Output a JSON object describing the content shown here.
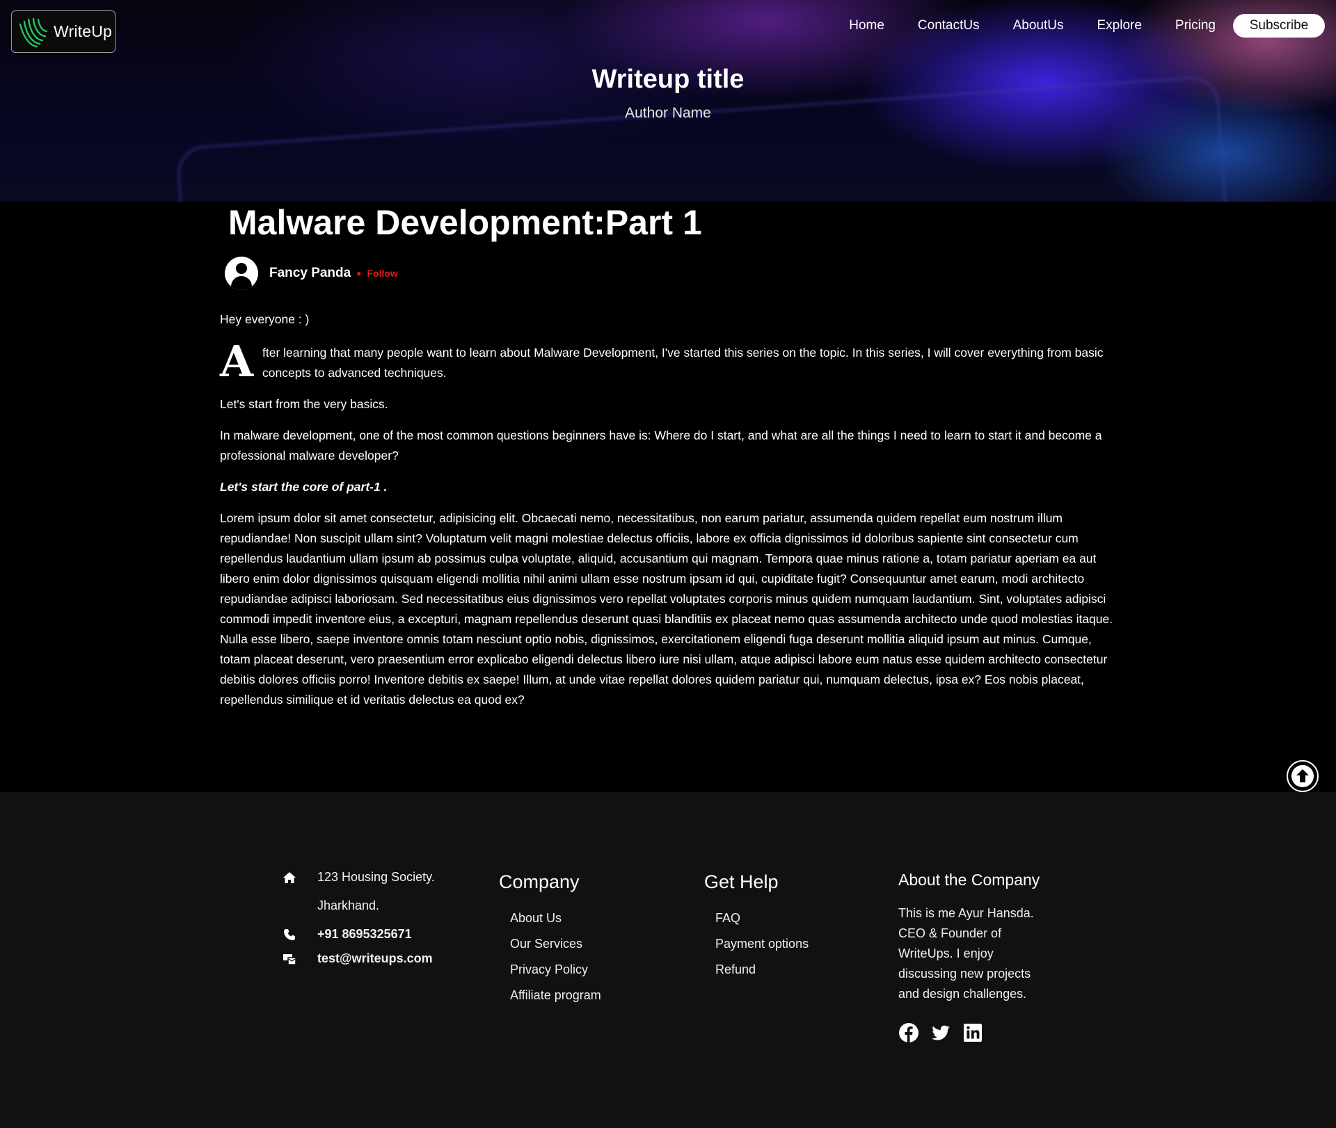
{
  "header": {
    "logo_text": "WriteUp",
    "nav": [
      "Home",
      "ContactUs",
      "AboutUs",
      "Explore",
      "Pricing"
    ],
    "subscribe_label": "Subscribe"
  },
  "hero": {
    "title": "Writeup title",
    "author": "Author Name"
  },
  "article": {
    "title": "Malware Development:Part 1",
    "author": "Fancy Panda",
    "follow_label": "Follow",
    "greeting": "Hey everyone : )",
    "dropcap": "A",
    "intro": "fter learning that many people want to learn about Malware Development, I've started this series on the topic. In this series, I will cover everything from basic concepts to advanced techniques.",
    "p2": "Let's start from the very basics.",
    "p3": "In malware development, one of the most common questions beginners have is: Where do I start, and what are all the things I need to learn to start it and become a professional malware developer?",
    "emphasis": "Let's start the core of part-1 .",
    "lorem": "Lorem ipsum dolor sit amet consectetur, adipisicing elit. Obcaecati nemo, necessitatibus, non earum pariatur, assumenda quidem repellat eum nostrum illum repudiandae! Non suscipit ullam sint? Voluptatum velit magni molestiae delectus officiis, labore ex officia dignissimos id doloribus sapiente sint consectetur cum repellendus laudantium ullam ipsum ab possimus culpa voluptate, aliquid, accusantium qui magnam. Tempora quae minus ratione a, totam pariatur aperiam ea aut libero enim dolor dignissimos quisquam eligendi mollitia nihil animi ullam esse nostrum ipsam id qui, cupiditate fugit? Consequuntur amet earum, modi architecto repudiandae adipisci laboriosam. Sed necessitatibus eius dignissimos vero repellat voluptates corporis minus quidem numquam laudantium. Sint, voluptates adipisci commodi impedit inventore eius, a excepturi, magnam repellendus deserunt quasi blanditiis ex placeat nemo quas assumenda architecto unde quod molestias itaque. Nulla esse libero, saepe inventore omnis totam nesciunt optio nobis, dignissimos, exercitationem eligendi fuga deserunt mollitia aliquid ipsum aut minus. Cumque, totam placeat deserunt, vero praesentium error explicabo eligendi delectus libero iure nisi ullam, atque adipisci labore eum natus esse quidem architecto consectetur debitis dolores officiis porro! Inventore debitis ex saepe! Illum, at unde vitae repellat dolores quidem pariatur qui, numquam delectus, ipsa ex? Eos nobis placeat, repellendus similique et id veritatis delectus ea quod ex?"
  },
  "footer": {
    "address_line1": "123 Housing Society.",
    "address_line2": "Jharkhand.",
    "phone": "+91 8695325671",
    "email": "test@writeups.com",
    "company_heading": "Company",
    "company_links": [
      "About Us",
      "Our Services",
      "Privacy Policy",
      "Affiliate program"
    ],
    "help_heading": "Get Help",
    "help_links": [
      "FAQ",
      "Payment options",
      "Refund"
    ],
    "about_heading": "About the Company",
    "about_text": "This is me Ayur Hansda. CEO & Founder of WriteUps. I enjoy discussing new projects and design challenges.",
    "social_icons": [
      "facebook-icon",
      "twitter-icon",
      "linkedin-icon"
    ]
  },
  "colors": {
    "accent_red": "#e31b1b",
    "logo_green": "#22c55e",
    "footer_bg": "#111111"
  }
}
